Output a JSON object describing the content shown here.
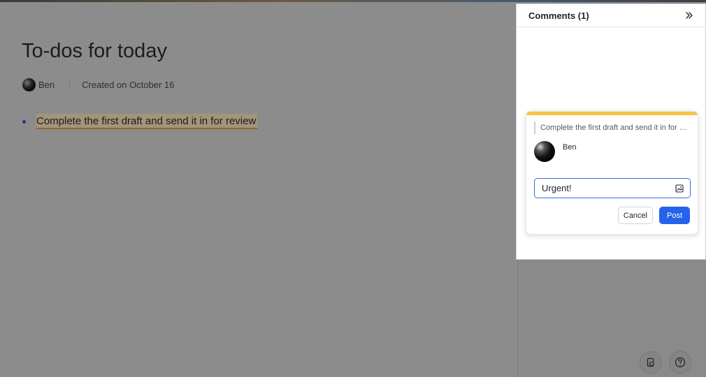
{
  "document": {
    "title": "To-dos for today",
    "author": "Ben",
    "created": "Created on October 16",
    "bullet": "Complete the first draft and send it in for review"
  },
  "comments_panel": {
    "title": "Comments (1)",
    "collapse_icon": "double-chevron-right-icon",
    "card": {
      "accent_color": "#f5c542",
      "quote": "Complete the first draft and send it in for review",
      "author": "Ben",
      "input_value": "Urgent!",
      "image_icon": "image-icon",
      "cancel_label": "Cancel",
      "post_label": "Post",
      "post_color": "#2463eb"
    }
  },
  "floating_buttons": {
    "doc_icon": "document-icon",
    "help_icon": "help-circle-icon"
  }
}
